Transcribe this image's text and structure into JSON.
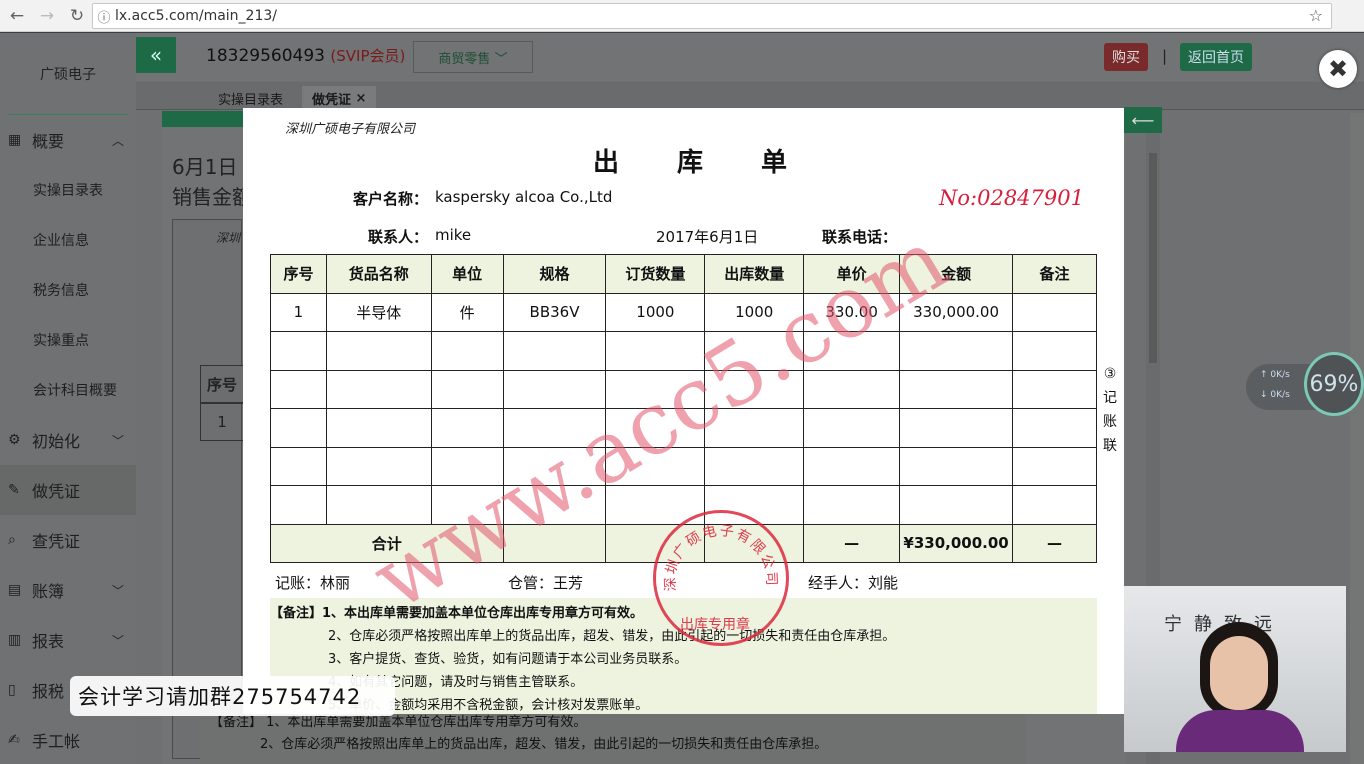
{
  "browser": {
    "url": "lx.acc5.com/main_213/"
  },
  "header": {
    "brand": "广硕电子",
    "phone": "18329560493",
    "vip": "(SVIP会员)",
    "mode": "商贸零售",
    "buy": "购买",
    "separator": "|",
    "home": "返回首页"
  },
  "tabs": [
    {
      "label": "实操目录表"
    },
    {
      "label": "做凭证",
      "close": "×"
    }
  ],
  "sidebar": {
    "items": [
      {
        "label": "概要",
        "icon": "▦",
        "chev": "︿"
      },
      {
        "label": "实操目录表"
      },
      {
        "label": "企业信息"
      },
      {
        "label": "税务信息"
      },
      {
        "label": "实操重点"
      },
      {
        "label": "会计科目概要"
      },
      {
        "label": "初始化",
        "icon": "⚙",
        "chev": "﹀"
      },
      {
        "label": "做凭证",
        "icon": "✎"
      },
      {
        "label": "查凭证",
        "icon": "⌕"
      },
      {
        "label": "账簿",
        "icon": "▤",
        "chev": "﹀"
      },
      {
        "label": "报表",
        "icon": "▥",
        "chev": "﹀"
      },
      {
        "label": "报税",
        "icon": "▯"
      },
      {
        "label": "手工帐",
        "icon": "✍"
      }
    ]
  },
  "background_doc": {
    "date": "6月1日",
    "amount": "销售金额",
    "company_short": "深圳",
    "col_head": "序号",
    "row_1": "1",
    "note_1": "【备注】 1、本出库单需要加盖本单位仓库出库专用章方可有效。",
    "note_2": "2、仓库必须严格按照出库单上的货品出库，超发、错发，由此引起的一切损失和责任由仓库承担。"
  },
  "document": {
    "company": "深圳广硕电子有限公司",
    "title": "出库单",
    "customer_label": "客户名称：",
    "customer": "kaspersky alcoa Co.,Ltd",
    "doc_no": "No:02847901",
    "contact_label": "联系人：",
    "contact": "mike",
    "date": "2017年6月1日",
    "phone_label": "联系电话：",
    "columns": [
      "序号",
      "货品名称",
      "单位",
      "规格",
      "订货数量",
      "出库数量",
      "单价",
      "金额",
      "备注"
    ],
    "rows": [
      [
        "1",
        "半导体",
        "件",
        "BB36V",
        "1000",
        "1000",
        "330.00",
        "330,000.00",
        ""
      ]
    ],
    "total_label": "合计",
    "total_price": "—",
    "total_amount": "¥330,000.00",
    "total_note": "—",
    "bookkeeper_label": "记账：林丽",
    "warehouse_label": "仓管：王芳",
    "handler_label": "经手人：刘能",
    "copy_label": "③记账联",
    "notes": [
      "【备注】1、本出库单需要加盖本单位仓库出库专用章方可有效。",
      "2、仓库必须严格按照出库单上的货品出库，超发、错发，由此引起的一切损失和责任由仓库承担。",
      "3、客户提货、查货、验货，如有问题请于本公司业务员联系。",
      "4、如有其它问题，请及时与销售主管联系。",
      "5、单价、金额均采用不含税金额，会计核对发票账单。"
    ],
    "watermark": "www.acc5.com",
    "stamp_top": "深圳广硕电子有限公司",
    "stamp_bottom": "出库专用章"
  },
  "overlay": {
    "qq": "会计学习请加群275754742",
    "close": "✖",
    "speed_up": "0K/s",
    "speed_down": "0K/s",
    "speed_pct": "69%",
    "webcam_text": "宁静致远"
  }
}
